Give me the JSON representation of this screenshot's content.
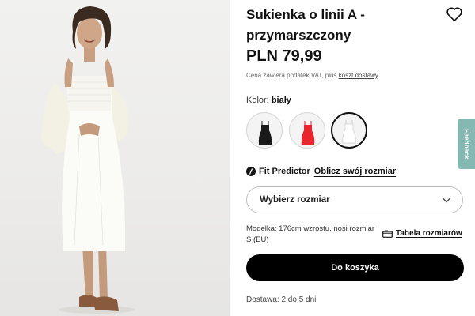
{
  "product": {
    "title": "Sukienka o linii A - przymarszczony",
    "price": "PLN 79,99",
    "tax_note": "Cena zawiera podatek VAT, plus",
    "shipping_link": "koszt dostawy",
    "image_alt": "Model in white A-line dress"
  },
  "color": {
    "label": "Kolor:",
    "selected": "biały",
    "swatches": [
      {
        "name": "black",
        "color": "#1a1a1a",
        "selected": false
      },
      {
        "name": "red",
        "color": "#e8262c",
        "selected": false
      },
      {
        "name": "white",
        "color": "#ffffff",
        "selected": true
      }
    ]
  },
  "fit": {
    "label": "Fit Predictor",
    "link": "Oblicz swój rozmiar"
  },
  "size": {
    "placeholder": "Wybierz rozmiar"
  },
  "model_info": "Modelka: 176cm wzrostu, nosi rozmiar S (EU)",
  "size_chart": "Tabela rozmiarów",
  "cart_button": "Do koszyka",
  "delivery": "Dostawa: 2 do 5 dni",
  "feedback": "Feedback",
  "icons": {
    "wishlist": "heart-icon",
    "fit": "fit-predictor-icon",
    "dropdown": "chevron-down-icon",
    "size_chart": "hanger-icon"
  }
}
